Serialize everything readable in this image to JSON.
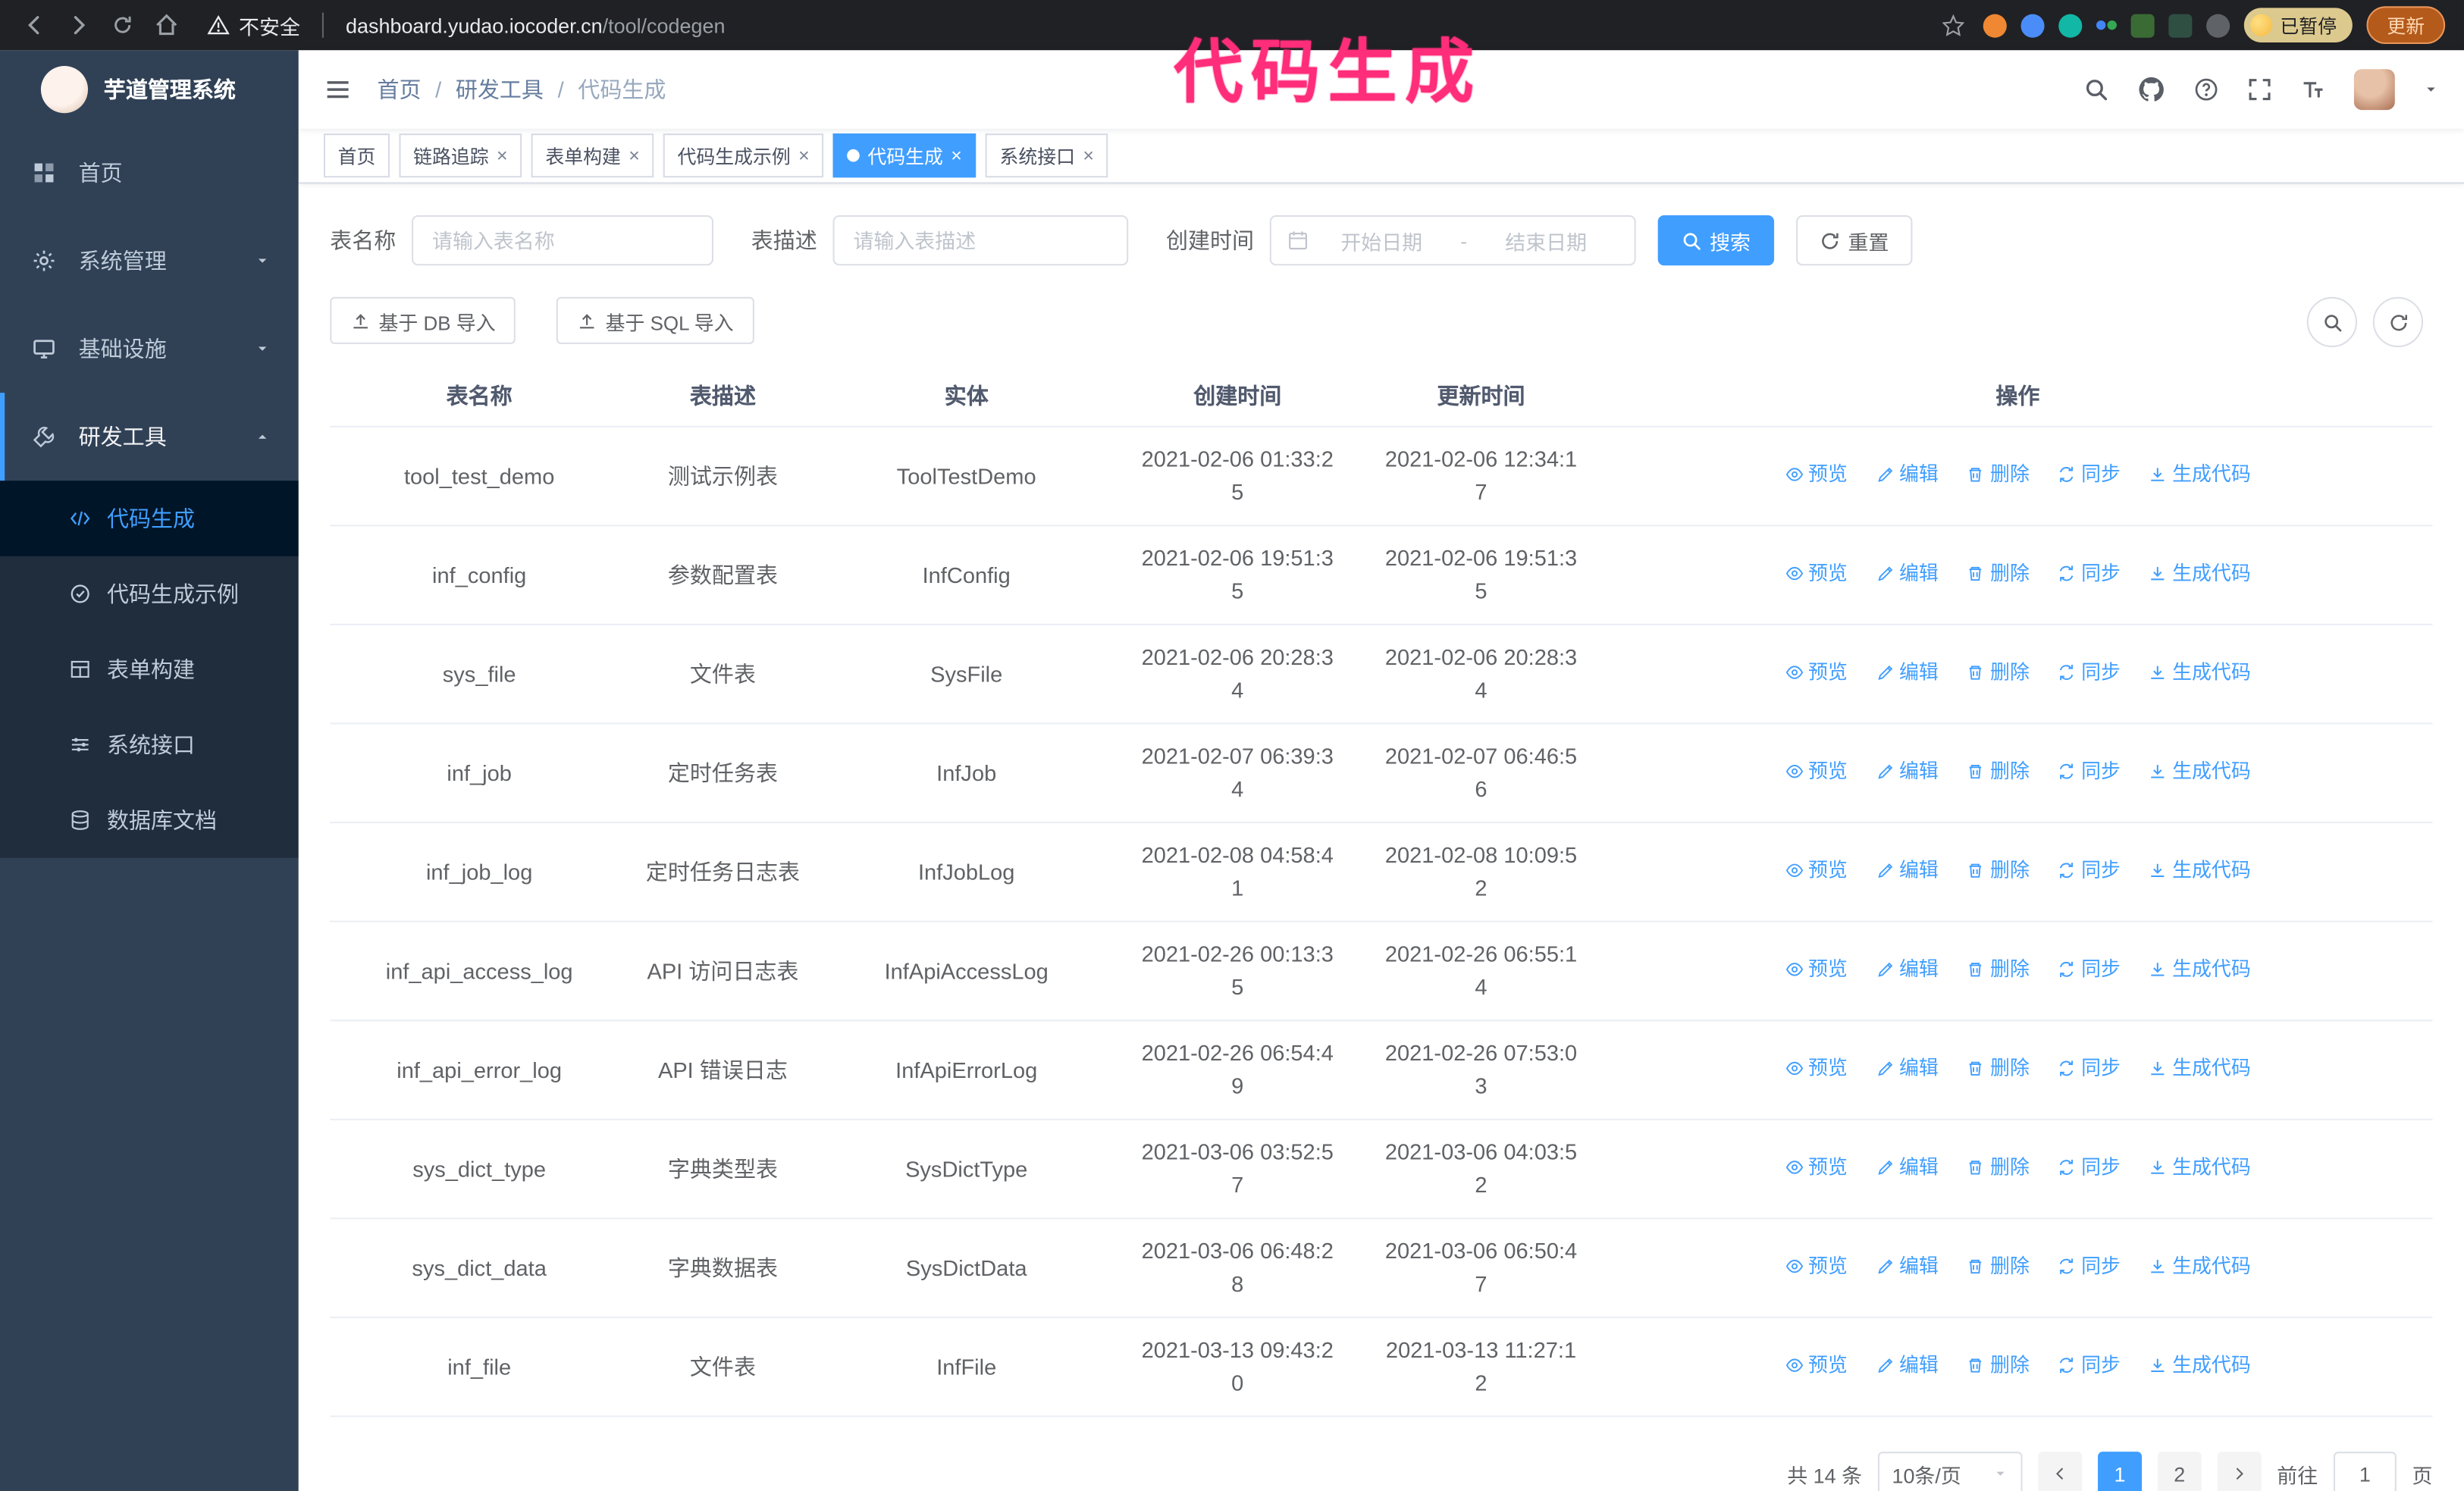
{
  "annotation": {
    "label": "代码生成"
  },
  "colors": {
    "primary": "#409eff",
    "annotation": "#ff2d7a",
    "sidebar_bg": "#304156",
    "submenu_bg": "#1f2d3d",
    "chrome_bg": "#202124"
  },
  "browser": {
    "security_label": "不安全",
    "url_host": "dashboard.yudao.iocoder.cn",
    "url_path": "/tool/codegen",
    "paused_badge": "已暂停",
    "update_button": "更新"
  },
  "sidebar": {
    "logo_title": "芋道管理系统",
    "items": [
      {
        "label": "首页"
      },
      {
        "label": "系统管理"
      },
      {
        "label": "基础设施"
      },
      {
        "label": "研发工具",
        "expanded": true
      }
    ],
    "subitems": [
      {
        "label": "代码生成",
        "active": true
      },
      {
        "label": "代码生成示例"
      },
      {
        "label": "表单构建"
      },
      {
        "label": "系统接口"
      },
      {
        "label": "数据库文档"
      }
    ]
  },
  "breadcrumb": {
    "sep": "/",
    "items": [
      "首页",
      "研发工具",
      "代码生成"
    ]
  },
  "tabs": [
    {
      "label": "首页"
    },
    {
      "label": "链路追踪"
    },
    {
      "label": "表单构建"
    },
    {
      "label": "代码生成示例"
    },
    {
      "label": "代码生成",
      "active": true
    },
    {
      "label": "系统接口"
    }
  ],
  "filters": {
    "name_label": "表名称",
    "name_placeholder": "请输入表名称",
    "desc_label": "表描述",
    "desc_placeholder": "请输入表描述",
    "time_label": "创建时间",
    "start_placeholder": "开始日期",
    "range_separator": "-",
    "end_placeholder": "结束日期",
    "search_label": "搜索",
    "reset_label": "重置"
  },
  "toolbar": {
    "import_db": "基于 DB 导入",
    "import_sql": "基于 SQL 导入"
  },
  "table": {
    "columns": [
      "表名称",
      "表描述",
      "实体",
      "创建时间",
      "更新时间",
      "操作"
    ],
    "actions": [
      "预览",
      "编辑",
      "删除",
      "同步",
      "生成代码"
    ],
    "rows": [
      {
        "name": "tool_test_demo",
        "desc": "测试示例表",
        "entity": "ToolTestDemo",
        "created": "2021-02-06 01:33:25",
        "updated": "2021-02-06 12:34:17"
      },
      {
        "name": "inf_config",
        "desc": "参数配置表",
        "entity": "InfConfig",
        "created": "2021-02-06 19:51:35",
        "updated": "2021-02-06 19:51:35"
      },
      {
        "name": "sys_file",
        "desc": "文件表",
        "entity": "SysFile",
        "created": "2021-02-06 20:28:34",
        "updated": "2021-02-06 20:28:34"
      },
      {
        "name": "inf_job",
        "desc": "定时任务表",
        "entity": "InfJob",
        "created": "2021-02-07 06:39:34",
        "updated": "2021-02-07 06:46:56"
      },
      {
        "name": "inf_job_log",
        "desc": "定时任务日志表",
        "entity": "InfJobLog",
        "created": "2021-02-08 04:58:41",
        "updated": "2021-02-08 10:09:52"
      },
      {
        "name": "inf_api_access_log",
        "desc": "API 访问日志表",
        "entity": "InfApiAccessLog",
        "created": "2021-02-26 00:13:35",
        "updated": "2021-02-26 06:55:14"
      },
      {
        "name": "inf_api_error_log",
        "desc": "API 错误日志",
        "entity": "InfApiErrorLog",
        "created": "2021-02-26 06:54:49",
        "updated": "2021-02-26 07:53:03"
      },
      {
        "name": "sys_dict_type",
        "desc": "字典类型表",
        "entity": "SysDictType",
        "created": "2021-03-06 03:52:57",
        "updated": "2021-03-06 04:03:52"
      },
      {
        "name": "sys_dict_data",
        "desc": "字典数据表",
        "entity": "SysDictData",
        "created": "2021-03-06 06:48:28",
        "updated": "2021-03-06 06:50:47"
      },
      {
        "name": "inf_file",
        "desc": "文件表",
        "entity": "InfFile",
        "created": "2021-03-13 09:43:20",
        "updated": "2021-03-13 11:27:12"
      }
    ]
  },
  "pagination": {
    "total": "共 14 条",
    "page_size": "10条/页",
    "page1": "1",
    "page2": "2",
    "goto_label": "前往",
    "goto_value": "1",
    "unit_label": "页"
  }
}
